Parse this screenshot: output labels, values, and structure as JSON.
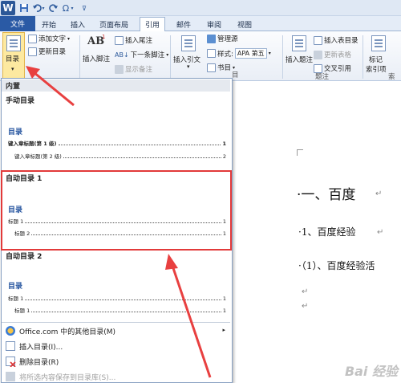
{
  "qat": {
    "word_icon": "W",
    "icons": [
      "save-icon",
      "undo-icon",
      "redo-icon",
      "symbol-icon",
      "customize-icon"
    ],
    "symbol_label": "Ω"
  },
  "tabs": [
    {
      "label": "文件"
    },
    {
      "label": "开始"
    },
    {
      "label": "插入"
    },
    {
      "label": "页面布局"
    },
    {
      "label": "引用"
    },
    {
      "label": "邮件"
    },
    {
      "label": "审阅"
    },
    {
      "label": "视图"
    }
  ],
  "ribbon": {
    "toc_label": "目录",
    "add_text": "添加文字",
    "update_toc": "更新目录",
    "footnote_big": "插入脚注",
    "ab_label": "AB",
    "insert_endnote": "插入尾注",
    "next_footnote": "下一条脚注",
    "show_notes": "显示备注",
    "insert_citation": "插入引文",
    "manage_sources": "管理源",
    "style_label": "样式:",
    "style_value": "APA 第五",
    "bibliography": "书目",
    "insert_caption": "插入题注",
    "insert_table_of_figures": "插入表目录",
    "update_table": "更新表格",
    "cross_reference": "交叉引用",
    "caption_group": "题注",
    "mark_entry": "标记",
    "mark_entry_line2": "索引项",
    "group_fragment": "目",
    "right_fragment": "索"
  },
  "gallery": {
    "builtin_header": "内置",
    "manual_toc_name": "手动目录",
    "manual": {
      "title": "目录",
      "lines": [
        {
          "text": "键入章标题(第 1 级)",
          "page": "1"
        },
        {
          "text": "键入章标题(第 2 级)",
          "page": "2"
        }
      ]
    },
    "auto1_name": "自动目录 1",
    "auto1": {
      "title": "目录",
      "lines": [
        {
          "text": "标题 1",
          "page": "1"
        },
        {
          "text": "标题 2",
          "page": "1"
        }
      ]
    },
    "auto2_name": "自动目录 2",
    "auto2": {
      "title": "目录",
      "lines": [
        {
          "text": "标题 1",
          "page": "1"
        },
        {
          "text": "标题 1",
          "page": "1"
        }
      ]
    },
    "menu": [
      {
        "label": "Office.com 中的其他目录(M)",
        "icon": "office-icon"
      },
      {
        "label": "插入目录(I)...",
        "icon": "insert-toc-icon"
      },
      {
        "label": "删除目录(R)",
        "icon": "delete-toc-icon"
      },
      {
        "label": "将所选内容保存到目录库(S)...",
        "icon": "save-selection-icon"
      }
    ]
  },
  "document": {
    "h1": "·一、百度",
    "h2": "·1、百度经验",
    "h3": "·（1）、百度经验活",
    "para_mark": "↵"
  },
  "watermark": "Bai 经验",
  "colors": {
    "highlight": "#e23a3a",
    "file_tab": "#2a5aa5",
    "toc_button": "#fde9a0"
  }
}
